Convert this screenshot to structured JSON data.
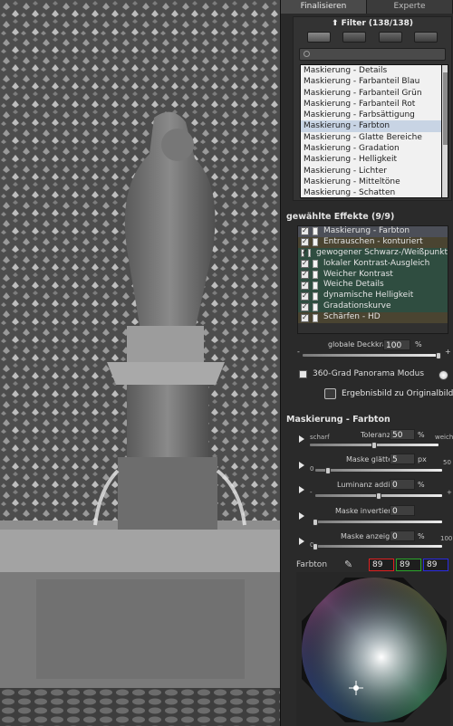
{
  "tabs": [
    "Finalisieren",
    "Experte"
  ],
  "filter": {
    "title": "Filter (138/138)",
    "items": [
      "Maskierung - Details",
      "Maskierung - Farbanteil Blau",
      "Maskierung - Farbanteil Grün",
      "Maskierung - Farbanteil Rot",
      "Maskierung - Farbsättigung",
      "Maskierung - Farbton",
      "Maskierung - Glatte Bereiche",
      "Maskierung - Gradation",
      "Maskierung - Helligkeit",
      "Maskierung - Lichter",
      "Maskierung - Mitteltöne",
      "Maskierung - Schatten"
    ],
    "selected_index": 5
  },
  "effects": {
    "title": "gewählte Effekte (9/9)",
    "items": [
      {
        "label": "Maskierung - Farbton",
        "style": "hdr"
      },
      {
        "label": "Entrauschen - konturiert",
        "style": "olive"
      },
      {
        "label": "gewogener Schwarz-/Weißpunkt",
        "style": "green"
      },
      {
        "label": "lokaler Kontrast-Ausgleich",
        "style": "green"
      },
      {
        "label": "Weicher Kontrast",
        "style": "green"
      },
      {
        "label": "Weiche Details",
        "style": "green"
      },
      {
        "label": "dynamische Helligkeit",
        "style": "green"
      },
      {
        "label": "Gradationskurve",
        "style": "green"
      },
      {
        "label": "Schärfen - HD",
        "style": "olive"
      }
    ],
    "opacity_label": "globale Deckkraft",
    "opacity_value": "100",
    "opacity_unit": "%",
    "opacity_level": 1.0,
    "panorama_label": "360-Grad Panorama Modus",
    "result_label": "Ergebnisbild zu Originalbild"
  },
  "masking": {
    "title": "Maskierung - Farbton",
    "tolerance": {
      "label": "Toleranz",
      "value": "50",
      "unit": "%",
      "left": "scharf",
      "right": "weich",
      "level": 0.5
    },
    "smooth": {
      "label": "Maske glätten",
      "value": "5",
      "unit": "px",
      "min": "0",
      "max": "50",
      "level": 0.1
    },
    "luminance": {
      "label": "Luminanz addieren",
      "value": "0",
      "unit": "%",
      "min": "-",
      "max": "+",
      "level": 0.5
    },
    "invert": {
      "label": "Maske invertieren",
      "value": "0",
      "level": 0.0
    },
    "show": {
      "label": "Maske anzeigen",
      "value": "0",
      "unit": "%",
      "min": "0",
      "max": "100",
      "level": 0.0
    },
    "hue_label": "Farbton",
    "rgb": [
      "89",
      "89",
      "89"
    ]
  },
  "colors": {
    "list_selected": "#c8d4e4",
    "effect_green": "#2f4d40",
    "effect_olive": "#4a4431"
  },
  "icons": [
    "up-arrow-icon",
    "search-icon",
    "play-icon",
    "eyedropper-icon",
    "compare-icon"
  ]
}
